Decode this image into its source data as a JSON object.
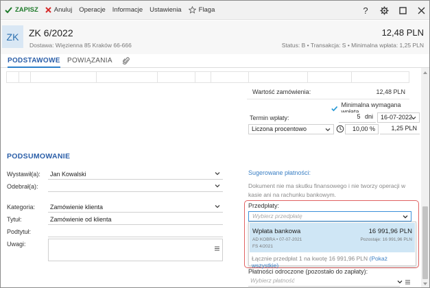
{
  "toolbar": {
    "save_label": "ZAPISZ",
    "cancel_label": "Anuluj",
    "operations_label": "Operacje",
    "info_label": "Informacje",
    "settings_label": "Ustawienia",
    "flag_label": "Flaga",
    "help_label": "?"
  },
  "header": {
    "badge": "ZK",
    "title": "ZK 6/2022",
    "delivery": "Dostawa: Więzienna  85 Kraków 66-666",
    "amount": "12,48 PLN",
    "status": "Status:  B  •  Transakcja:  S  •  Minimalna wpłata: 1,25 PLN"
  },
  "tabs": [
    {
      "label": "PODSTAWOWE"
    },
    {
      "label": "POWIĄZANIA"
    }
  ],
  "order": {
    "value_label": "Wartość zamówienia:",
    "value": "12,48 PLN",
    "min_payment_label": "Minimalna wymagana wpłata",
    "term_label": "Termin wpłaty:",
    "days_value": "5",
    "days_unit": "dni",
    "date_value": "16-07-2022",
    "calc_mode": "Liczona procentowo",
    "percent_value": "10,00 %",
    "min_amount": "1,25 PLN"
  },
  "summary": {
    "title": "PODSUMOWANIE",
    "issued_by_label": "Wystawił(a):",
    "issued_by_value": "Jan Kowalski",
    "received_by_label": "Odebrał(a):",
    "received_by_value": "",
    "category_label": "Kategoria:",
    "category_value": "Zamówienie klienta",
    "title_label": "Tytuł:",
    "title_value": "Zamówienie od klienta",
    "subtitle_label": "Podtytuł:",
    "subtitle_value": "",
    "notes_label": "Uwagi:"
  },
  "payments": {
    "suggested_title": "Sugerowane płatności:",
    "suggested_text": "Dokument nie ma skutku finansowego i nie tworzy operacji w kasie ani na rachunku bankowym.",
    "prepayments_label": "Przedpłaty:",
    "prepayments_placeholder": "Wybierz przedpłatę",
    "item_name": "Wpłata bankowa",
    "item_amount": "16 991,96 PLN",
    "item_meta": "AD KOBRA • 07-07-2021",
    "item_rest": "Pozostaje: 16 991,96 PLN",
    "item_doc": "FS 4/2021",
    "footer_text": "Łącznie przedpłat 1 na kwotę 16 991,96 PLN",
    "footer_link": "(Pokaż wszystkie)",
    "deferred_label": "Płatności odroczone (pozostało do zapłaty):",
    "deferred_placeholder": "Wybierz płatność"
  },
  "colors": {
    "accent": "#2a5ea8",
    "save_green": "#1e7a2a",
    "cancel_red": "#d62b2b",
    "highlight_red": "#e06060",
    "selected_item": "#cfe6f5"
  }
}
